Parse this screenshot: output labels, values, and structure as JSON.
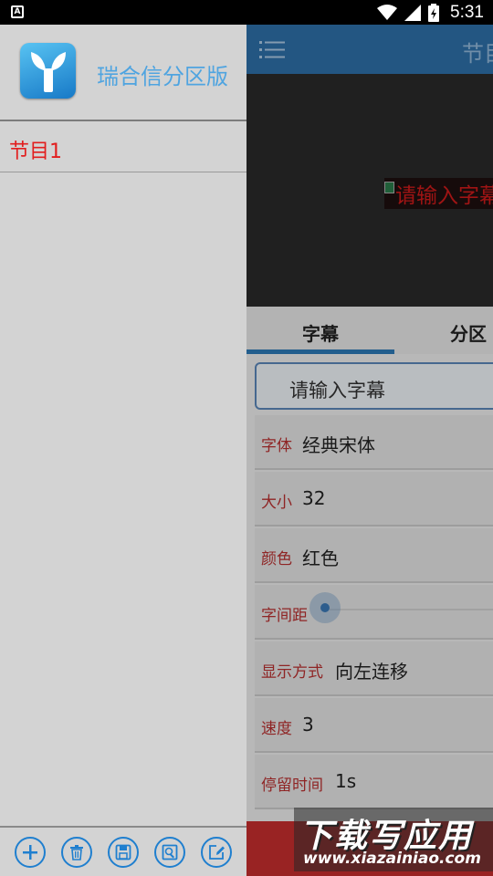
{
  "status_bar": {
    "left_icon": "a-icon",
    "time": "5:31",
    "icons": [
      "wifi-icon",
      "signal-icon",
      "battery-icon"
    ]
  },
  "drawer": {
    "app_name": "瑞合信分区版",
    "logo_icon": "sprout-icon",
    "items": [
      {
        "label": "节目1"
      }
    ],
    "bottom_buttons": [
      {
        "icon": "add-icon"
      },
      {
        "icon": "trash-icon"
      },
      {
        "icon": "save-icon"
      },
      {
        "icon": "image-search-icon"
      },
      {
        "icon": "edit-icon"
      }
    ]
  },
  "main": {
    "toolbar_title": "节目",
    "preview_text": "请输入字幕",
    "tabs": [
      {
        "label": "字幕",
        "active": true
      },
      {
        "label": "分区",
        "active": false
      }
    ],
    "input": {
      "value": "请输入字幕"
    },
    "settings": [
      {
        "label": "字体",
        "value": "经典宋体"
      },
      {
        "label": "大小",
        "value": "32"
      },
      {
        "label": "颜色",
        "value": "红色"
      },
      {
        "label": "字间距",
        "value": ""
      },
      {
        "label": "显示方式",
        "value": "向左连移"
      },
      {
        "label": "速度",
        "value": "3"
      },
      {
        "label": "停留时间",
        "value": "1s"
      }
    ]
  },
  "watermark": {
    "title": "下载写应用",
    "url": "www.xiazainiao.com"
  },
  "colors": {
    "primary": "#2d6fa7",
    "accent_red": "#e21e1e",
    "label_red": "#b83030",
    "app_name_blue": "#4fa4e0"
  }
}
